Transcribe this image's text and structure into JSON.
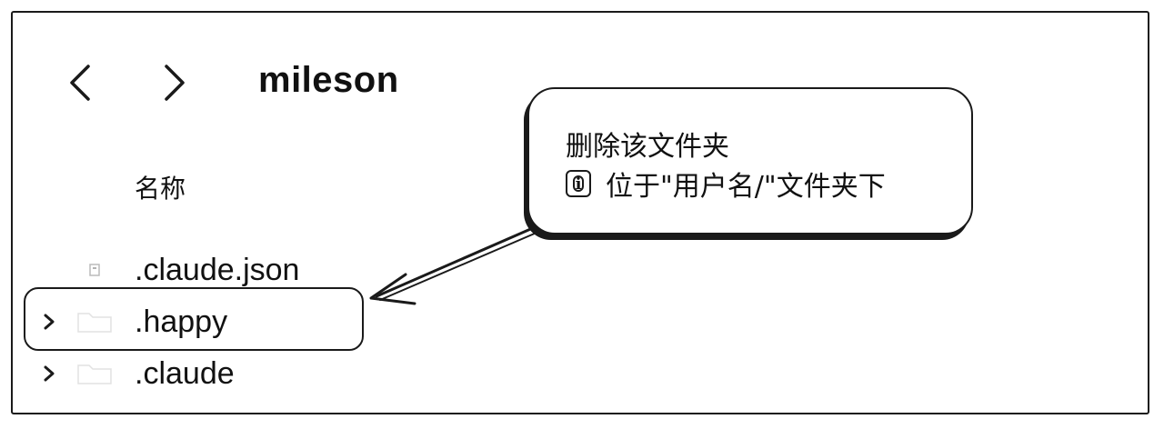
{
  "window": {
    "folder_title": "mileson"
  },
  "nav": {
    "back_icon": "chevron-left-icon",
    "forward_icon": "chevron-right-icon"
  },
  "table": {
    "column_header": "名称",
    "rows": [
      {
        "name": ".claude.json",
        "type": "file",
        "expandable": false
      },
      {
        "name": ".happy",
        "type": "folder",
        "expandable": true,
        "highlighted": true
      },
      {
        "name": ".claude",
        "type": "folder",
        "expandable": true
      }
    ]
  },
  "callout": {
    "title": "删除该文件夹",
    "note_icon": "info-icon",
    "note": "位于\"用户名/\"文件夹下"
  },
  "colors": {
    "ink": "#1a1a1a",
    "background": "#ffffff"
  }
}
